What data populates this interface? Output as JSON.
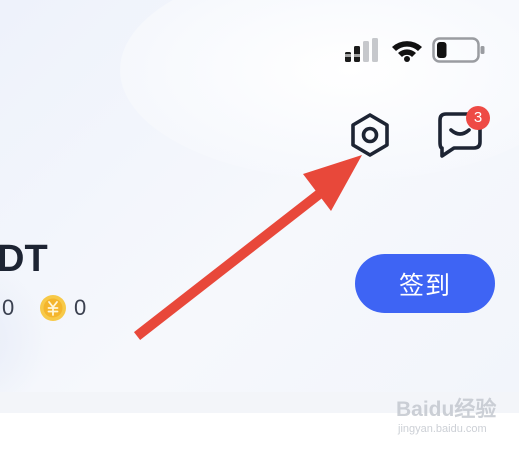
{
  "status_bar": {
    "signal_icon": "cellular-signal-icon",
    "wifi_icon": "wifi-icon",
    "battery_icon": "battery-icon",
    "battery_level": 0.25
  },
  "header": {
    "settings_icon": "settings-hexagon-icon",
    "messages_icon": "message-icon",
    "messages_badge": "3"
  },
  "profile": {
    "username_visible": "DT",
    "stat_left_value": "0",
    "coin_icon": "coin-icon",
    "stat_right_value": "0"
  },
  "checkin": {
    "label": "签到"
  },
  "colors": {
    "accent": "#3e64f4",
    "badge": "#ee4a45",
    "arrow": "#e8483a",
    "coin": "#f4b52c"
  },
  "watermark": {
    "brand": "Baidu经验",
    "url": "jingyan.baidu.com"
  }
}
